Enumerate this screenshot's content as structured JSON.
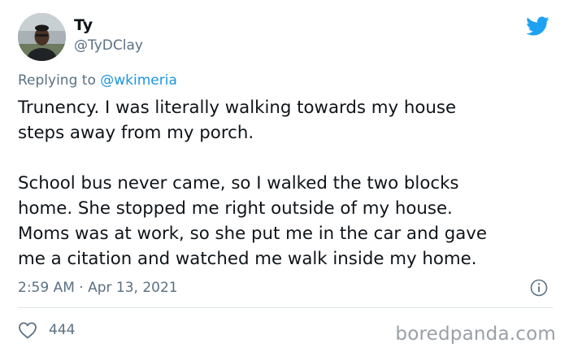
{
  "author": {
    "name": "Ty",
    "handle": "@TyDClay"
  },
  "reply": {
    "prefix": "Replying to ",
    "mention": "@wkimeria"
  },
  "tweet": {
    "lines": [
      "Trunency. I was literally walking towards my house",
      "steps away from my porch.",
      "",
      "School bus never came, so I walked the two blocks",
      "home. She stopped me right outside of my house.",
      "Moms was at work, so she put me in the car and gave",
      "me a citation and watched me walk inside my home."
    ]
  },
  "meta": {
    "timestamp": "2:59 AM · Apr 13, 2021"
  },
  "actions": {
    "like_count": "444"
  },
  "watermark": "boredpanda.com",
  "icons": {
    "brand": "twitter-bird-icon",
    "info": "info-icon",
    "like": "heart-icon"
  },
  "colors": {
    "brand_blue": "#1da1f2",
    "link_blue": "#1b95e0",
    "secondary_text": "#5b7083",
    "primary_text": "#0f1419",
    "divider": "#dfe5ea",
    "watermark": "#9aa0a6"
  }
}
